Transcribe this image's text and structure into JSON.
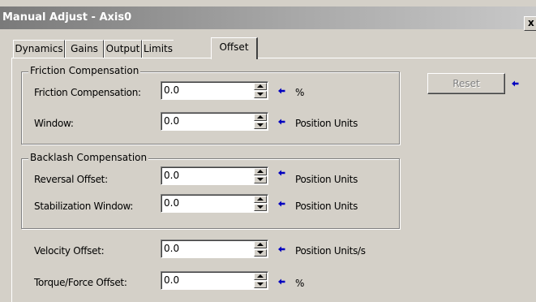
{
  "window": {
    "title": "Manual Adjust - Axis0",
    "close_glyph": "x"
  },
  "tabs": [
    {
      "label": "Dynamics"
    },
    {
      "label": "Gains"
    },
    {
      "label": "Output"
    },
    {
      "label": "Limits"
    },
    {
      "label": "Offset",
      "active": true
    }
  ],
  "friction_group": {
    "title": "Friction Compensation",
    "fields": [
      {
        "label": "Friction Compensation:",
        "value": "0.0",
        "unit": "%"
      },
      {
        "label": "Window:",
        "value": "0.0",
        "unit": "Position Units"
      }
    ]
  },
  "backlash_group": {
    "title": "Backlash Compensation",
    "fields": [
      {
        "label": "Reversal Offset:",
        "value": "0.0",
        "unit": "Position Units"
      },
      {
        "label": "Stabilization Window:",
        "value": "0.0",
        "unit": "Position Units"
      }
    ]
  },
  "other_fields": [
    {
      "label": "Velocity Offset:",
      "value": "0.0",
      "unit": "Position Units/s"
    },
    {
      "label": "Torque/Force Offset:",
      "value": "0.0",
      "unit": "%"
    }
  ],
  "reset_button": {
    "label": "Reset",
    "enabled": false
  },
  "colors": {
    "arrow": "#0000c0",
    "title_bar": "#7a7a7a",
    "face": "#d4d0c8"
  },
  "icons": {
    "pending_change": "left-arrow-icon",
    "spin_up": "spin-up-icon",
    "spin_down": "spin-down-icon"
  }
}
